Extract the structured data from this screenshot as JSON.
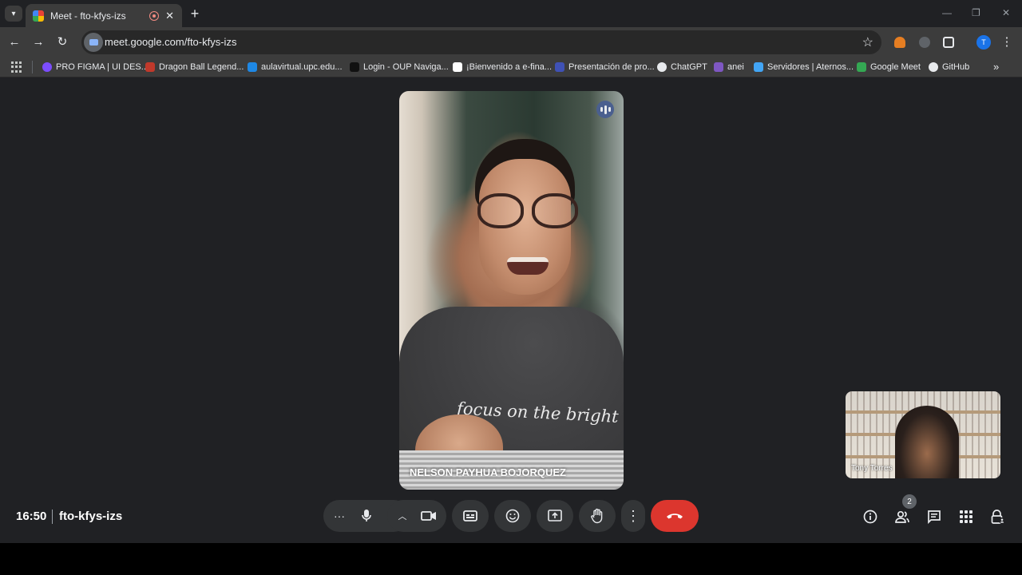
{
  "browser": {
    "tab": {
      "title": "Meet - fto-kfys-izs"
    },
    "new_tab": "+",
    "url": "meet.google.com/fto-kfys-izs",
    "profile_initial": "T",
    "bookmarks": [
      {
        "label": "PRO FIGMA | UI DES...",
        "color": "#7c4dff"
      },
      {
        "label": "Dragon Ball Legend...",
        "color": "#c0392b"
      },
      {
        "label": "aulavirtual.upc.edu...",
        "color": "#1e88e5"
      },
      {
        "label": "Login - OUP Naviga...",
        "color": "#111111"
      },
      {
        "label": "¡Bienvenido a e-fina...",
        "color": "#ffffff"
      },
      {
        "label": "Presentación de pro...",
        "color": "#3f51b5"
      },
      {
        "label": "ChatGPT",
        "color": "#e8eaed"
      },
      {
        "label": "anei",
        "color": "#7e57c2"
      },
      {
        "label": "Servidores | Aternos...",
        "color": "#42a5f5"
      },
      {
        "label": "Google Meet",
        "color": "#34a853"
      },
      {
        "label": "GitHub",
        "color": "#e8eaed"
      }
    ],
    "bookmarks_more": "»"
  },
  "meet": {
    "main_participant": {
      "name": "NELSON PAYHUA BOJORQUEZ",
      "shirt_text": "focus on the bright side"
    },
    "self_view": {
      "name": "Tony Torres"
    },
    "time": "16:50",
    "meeting_code": "fto-kfys-izs",
    "participant_count": "2",
    "end_call_color": "#dc362e"
  }
}
